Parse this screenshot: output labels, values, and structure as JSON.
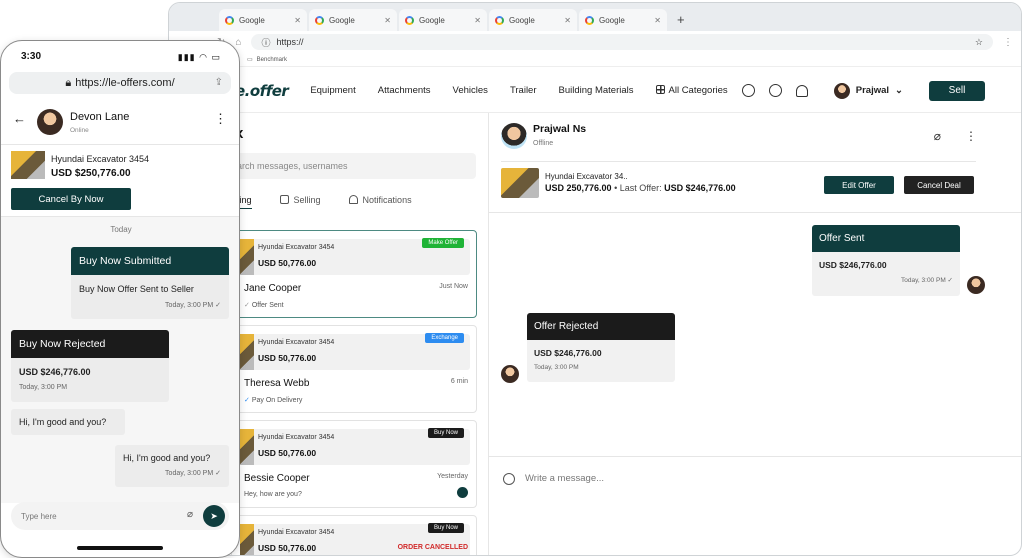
{
  "browser": {
    "tabs": [
      "Google",
      "Google",
      "Google",
      "Google",
      "Google"
    ],
    "url": "https://",
    "bookmark": "Benchmark"
  },
  "nav": {
    "logo": "e.offer",
    "links": [
      "Equipment",
      "Attachments",
      "Vehicles",
      "Trailer",
      "Building Materials"
    ],
    "all_categories": "All Categories",
    "user": "Prajwal",
    "sell": "Sell"
  },
  "inbox": {
    "title": "x",
    "search_placeholder": "arch messages, usernames",
    "tabs": [
      "ying",
      "Selling",
      "Notifications"
    ],
    "cards": [
      {
        "title": "Hyundai Excavator 3454",
        "price": "USD 50,776.00",
        "badge": "Make Offer",
        "badge_color": "#1fb336",
        "name": "Jane Cooper",
        "time": "Just Now",
        "sub": "Offer Sent"
      },
      {
        "title": "Hyundai Excavator 3454",
        "price": "USD 50,776.00",
        "badge": "Exchange",
        "badge_color": "#2d8cf0",
        "name": "Theresa Webb",
        "time": "6 min",
        "sub": "Pay On Delivery"
      },
      {
        "title": "Hyundai Excavator 3454",
        "price": "USD 50,776.00",
        "badge": "Buy Now",
        "badge_color": "#1b1b1b",
        "name": "Bessie Cooper",
        "time": "Yesterday",
        "sub": "Hey, how are you?"
      },
      {
        "title": "Hyundai Excavator 3454",
        "price": "USD 50,776.00",
        "badge": "Buy Now",
        "badge_color": "#1b1b1b",
        "sub": "ORDER CANCELLED"
      }
    ]
  },
  "chat": {
    "name": "Prajwal Ns",
    "status": "Offline",
    "offer_title": "Hyundai Excavator 34..",
    "offer_price": "USD 250,776.00",
    "last_offer_label": "Last Offer:",
    "last_offer_value": "USD $246,776.00",
    "edit": "Edit Offer",
    "cancel": "Cancel Deal",
    "messages": [
      {
        "header": "Offer Sent",
        "value": "USD $246,776.00",
        "time": "Today, 3:00 PM"
      },
      {
        "header": "Offer Rejected",
        "value": "USD $246,776.00",
        "time": "Today, 3:00 PM"
      }
    ],
    "placeholder": "Write a message..."
  },
  "phone": {
    "time": "3:30",
    "url": "https://le-offers.com/",
    "name": "Devon Lane",
    "status": "Online",
    "offer_title": "Hyundai Excavator 3454",
    "offer_price": "USD $250,776.00",
    "cancel": "Cancel By Now",
    "today": "Today",
    "msgs": [
      {
        "header": "Buy Now Submitted",
        "body": "Buy Now Offer Sent to Seller",
        "time": "Today, 3:00 PM"
      },
      {
        "header": "Buy Now Rejected",
        "body": "USD $246,776.00",
        "time": "Today, 3:00 PM"
      },
      {
        "body": "Hi, I'm good and you?"
      },
      {
        "body": "Hi, I'm good and you?",
        "time": "Today, 3:00 PM"
      }
    ],
    "input_placeholder": "Type here"
  },
  "colors": {
    "brand": "#0f3d3e",
    "dark": "#1b1b1b",
    "danger": "#d12a2a"
  }
}
